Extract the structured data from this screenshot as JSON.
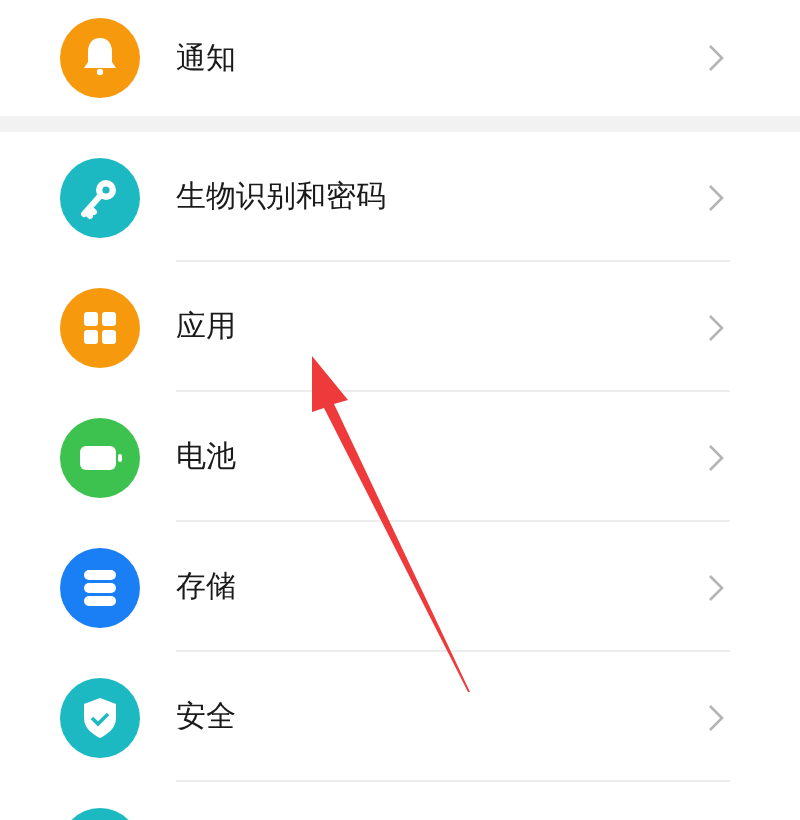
{
  "groups": [
    {
      "items": [
        {
          "kind": "bell",
          "color": "#f7990c",
          "label": "通知"
        }
      ]
    },
    {
      "items": [
        {
          "kind": "key",
          "color": "#1cb9c3",
          "label": "生物识别和密码"
        },
        {
          "kind": "grid",
          "color": "#f7990c",
          "label": "应用"
        },
        {
          "kind": "battery",
          "color": "#3dc24f",
          "label": "电池"
        },
        {
          "kind": "storage",
          "color": "#1a7ff5",
          "label": "存储"
        },
        {
          "kind": "shield",
          "color": "#1cb9c3",
          "label": "安全"
        },
        {
          "kind": "blank",
          "color": "#1cb9c3"
        }
      ]
    }
  ]
}
